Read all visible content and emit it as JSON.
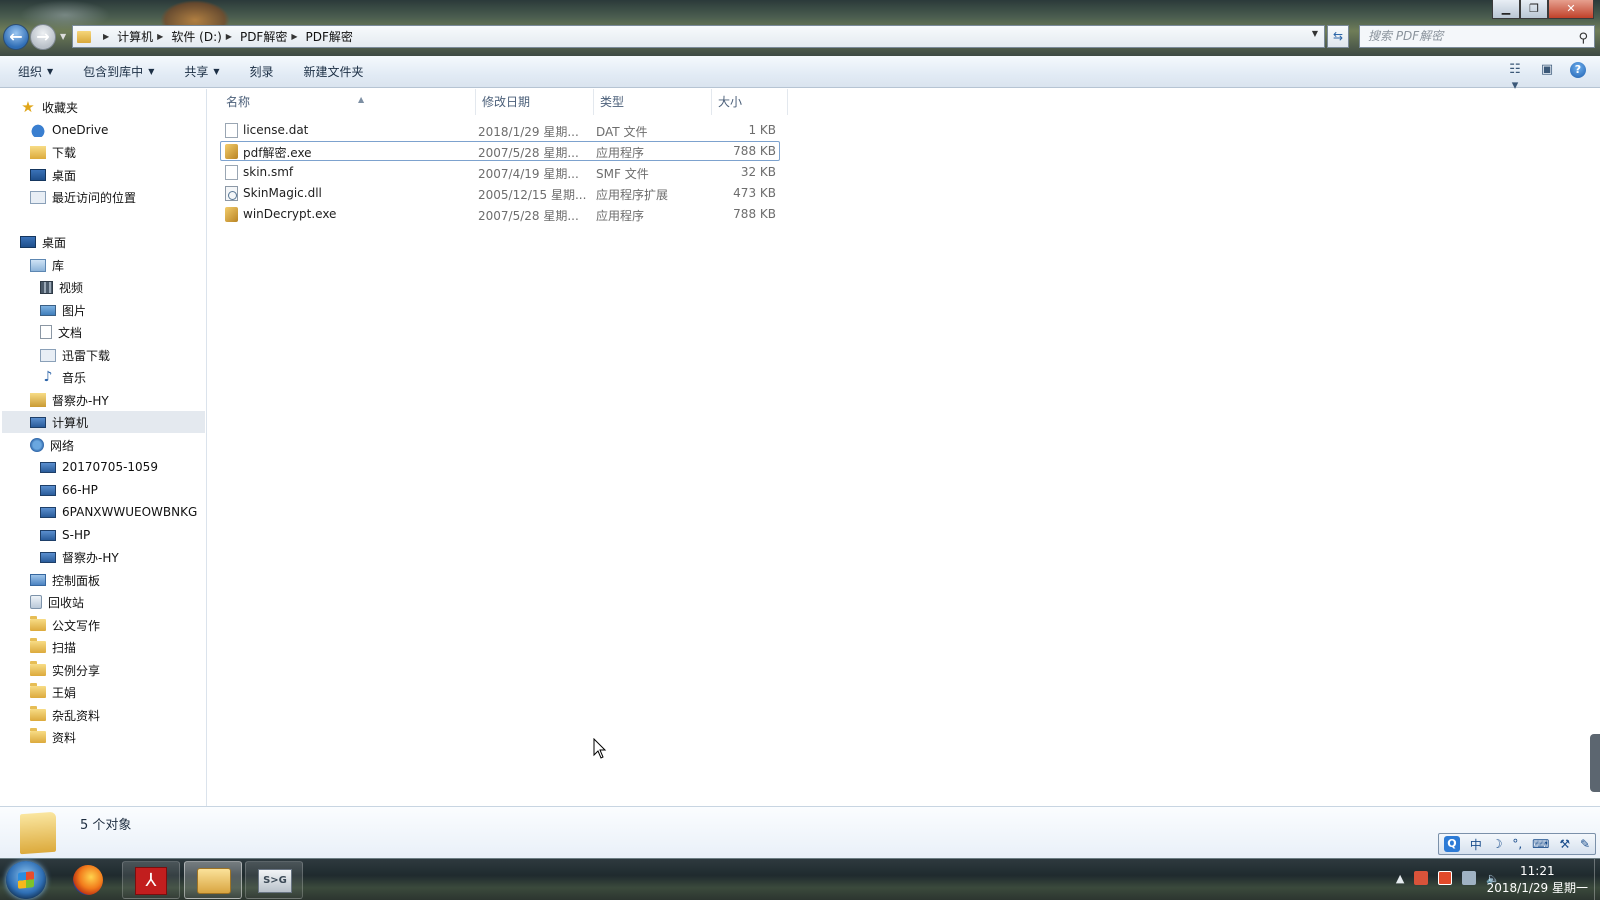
{
  "window": {
    "min_label": "▁",
    "max_label": "❐",
    "close_label": "✕"
  },
  "address": {
    "crumbs": [
      "计算机",
      "软件 (D:)",
      "PDF解密",
      "PDF解密"
    ],
    "search_placeholder": "搜索 PDF解密"
  },
  "toolbar": {
    "organize": "组织",
    "include_library": "包含到库中",
    "share": "共享",
    "burn": "刻录",
    "new_folder": "新建文件夹"
  },
  "sidebar": {
    "favorites": "收藏夹",
    "onedrive": "OneDrive",
    "downloads": "下载",
    "desktop_fav": "桌面",
    "recent": "最近访问的位置",
    "desktop": "桌面",
    "libraries": "库",
    "videos": "视频",
    "pictures": "图片",
    "documents": "文档",
    "xunlei": "迅雷下载",
    "music": "音乐",
    "user": "督察办-HY",
    "computer": "计算机",
    "network": "网络",
    "net_items": [
      "20170705-1059",
      "66-HP",
      "6PANXWWUEOWBNKG",
      "S-HP",
      "督察办-HY"
    ],
    "control_panel": "控制面板",
    "recycle_bin": "回收站",
    "folders": [
      "公文写作",
      "扫描",
      "实例分享",
      "王娟",
      "杂乱资料",
      "资料"
    ]
  },
  "columns": {
    "name": "名称",
    "date": "修改日期",
    "type": "类型",
    "size": "大小"
  },
  "files": [
    {
      "name": "license.dat",
      "date": "2018/1/29 星期...",
      "type": "DAT 文件",
      "size": "1 KB",
      "icon": "dat-file-icon"
    },
    {
      "name": "pdf解密.exe",
      "date": "2007/5/28 星期...",
      "type": "应用程序",
      "size": "788 KB",
      "icon": "exe-app-icon"
    },
    {
      "name": "skin.smf",
      "date": "2007/4/19 星期...",
      "type": "SMF 文件",
      "size": "32 KB",
      "icon": "smf-file-icon"
    },
    {
      "name": "SkinMagic.dll",
      "date": "2005/12/15 星期...",
      "type": "应用程序扩展",
      "size": "473 KB",
      "icon": "dll-file-icon"
    },
    {
      "name": "winDecrypt.exe",
      "date": "2007/5/28 星期...",
      "type": "应用程序",
      "size": "788 KB",
      "icon": "exe-app-icon"
    }
  ],
  "status": {
    "count": "5 个对象"
  },
  "ime": {
    "mode": "中",
    "q": "Q"
  },
  "taskbar": {
    "time": "11:21",
    "date": "2018/1/29 星期一",
    "remote_label": "S>G"
  }
}
